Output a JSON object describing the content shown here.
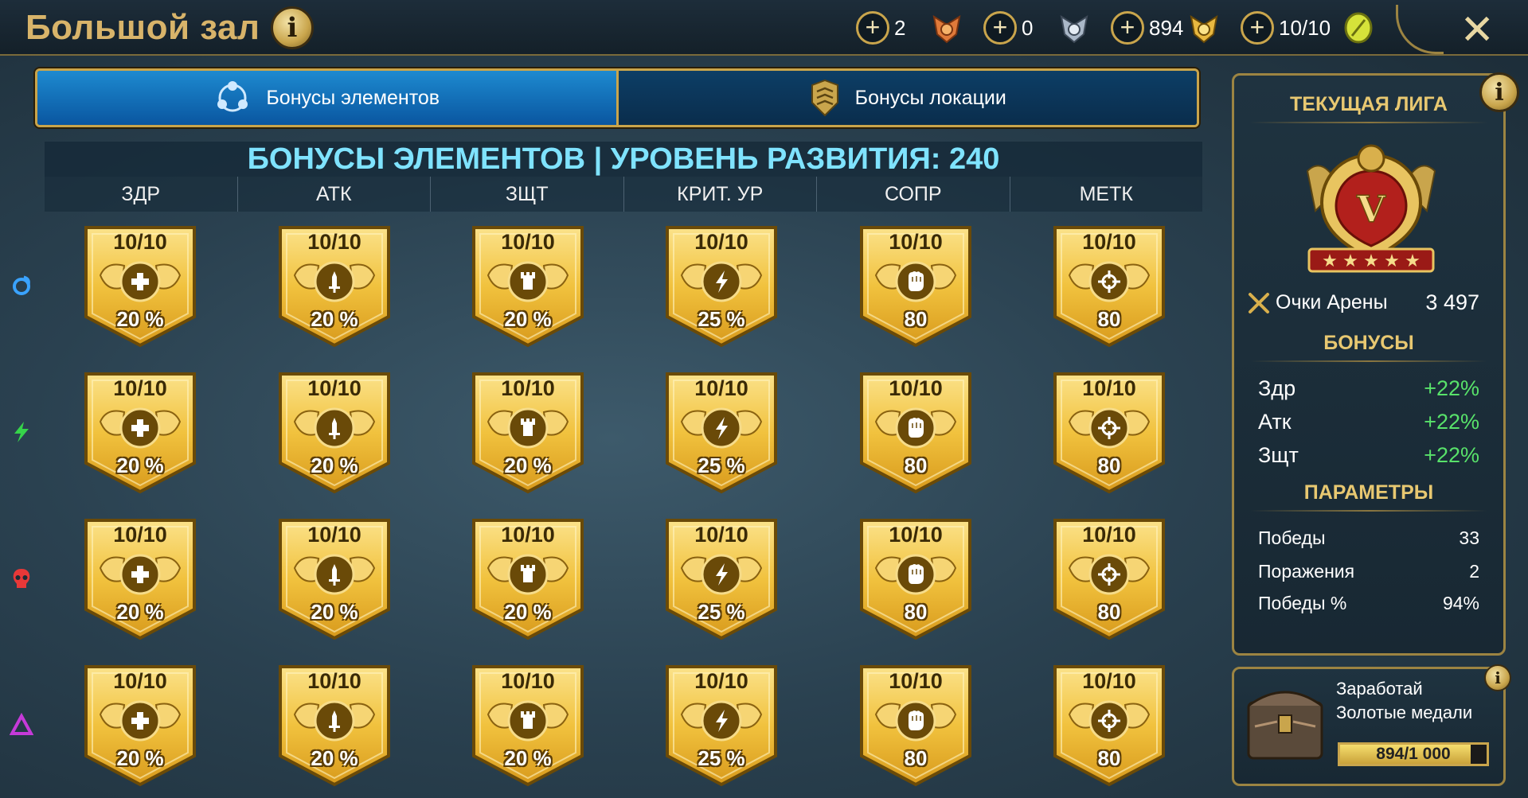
{
  "header": {
    "title": "Большой зал",
    "resources": [
      {
        "value": "2",
        "icon": "orange-medal-icon",
        "color": "#e07a3a"
      },
      {
        "value": "0",
        "icon": "silver-medal-icon",
        "color": "#aab8c8"
      },
      {
        "value": "894",
        "icon": "gold-medal-icon",
        "color": "#e8b840"
      },
      {
        "value": "10/10",
        "icon": "arena-token-icon",
        "color": "#d6e23a"
      }
    ]
  },
  "tabs": [
    {
      "label": "Бонусы элементов",
      "active": true,
      "icon": "elements-icon"
    },
    {
      "label": "Бонусы локации",
      "active": false,
      "icon": "location-icon"
    }
  ],
  "grid": {
    "title": "БОНУСЫ ЭЛЕМЕНТОВ | УРОВЕНЬ РАЗВИТИЯ: 240",
    "columns": [
      {
        "label": "ЗДР",
        "icon": "health-icon"
      },
      {
        "label": "АТК",
        "icon": "sword-icon"
      },
      {
        "label": "ЗЩТ",
        "icon": "tower-icon"
      },
      {
        "label": "КРИТ. УР",
        "icon": "lightning-icon"
      },
      {
        "label": "СОПР",
        "icon": "fist-icon"
      },
      {
        "label": "МЕТК",
        "icon": "crosshair-icon"
      }
    ],
    "rows": [
      {
        "affinity": "magic",
        "icon": "magic-affinity-icon",
        "color": "#3aa3ff",
        "cells": [
          {
            "level": "10/10",
            "value": "20 %"
          },
          {
            "level": "10/10",
            "value": "20 %"
          },
          {
            "level": "10/10",
            "value": "20 %"
          },
          {
            "level": "10/10",
            "value": "25 %"
          },
          {
            "level": "10/10",
            "value": "80"
          },
          {
            "level": "10/10",
            "value": "80"
          }
        ]
      },
      {
        "affinity": "spirit",
        "icon": "spirit-affinity-icon",
        "color": "#36d44a",
        "cells": [
          {
            "level": "10/10",
            "value": "20 %"
          },
          {
            "level": "10/10",
            "value": "20 %"
          },
          {
            "level": "10/10",
            "value": "20 %"
          },
          {
            "level": "10/10",
            "value": "25 %"
          },
          {
            "level": "10/10",
            "value": "80"
          },
          {
            "level": "10/10",
            "value": "80"
          }
        ]
      },
      {
        "affinity": "force",
        "icon": "force-affinity-icon",
        "color": "#e83838",
        "cells": [
          {
            "level": "10/10",
            "value": "20 %"
          },
          {
            "level": "10/10",
            "value": "20 %"
          },
          {
            "level": "10/10",
            "value": "20 %"
          },
          {
            "level": "10/10",
            "value": "25 %"
          },
          {
            "level": "10/10",
            "value": "80"
          },
          {
            "level": "10/10",
            "value": "80"
          }
        ]
      },
      {
        "affinity": "void",
        "icon": "void-affinity-icon",
        "color": "#c53ad8",
        "cells": [
          {
            "level": "10/10",
            "value": "20 %"
          },
          {
            "level": "10/10",
            "value": "20 %"
          },
          {
            "level": "10/10",
            "value": "20 %"
          },
          {
            "level": "10/10",
            "value": "25 %"
          },
          {
            "level": "10/10",
            "value": "80"
          },
          {
            "level": "10/10",
            "value": "80"
          }
        ]
      }
    ]
  },
  "league": {
    "title": "ТЕКУЩАЯ ЛИГА",
    "rank": "V",
    "points_label": "Очки Арены",
    "points_value": "3 497",
    "bonuses_title": "БОНУСЫ",
    "bonuses": [
      {
        "label": "Здр",
        "value": "+22%"
      },
      {
        "label": "Атк",
        "value": "+22%"
      },
      {
        "label": "Зщт",
        "value": "+22%"
      }
    ],
    "params_title": "ПАРАМЕТРЫ",
    "params": [
      {
        "label": "Победы",
        "value": "33"
      },
      {
        "label": "Поражения",
        "value": "2"
      },
      {
        "label": "Победы %",
        "value": "94%"
      }
    ]
  },
  "earn": {
    "line1": "Заработай",
    "line2": "Золотые медали",
    "progress_text": "894/1 000",
    "progress_fraction": 0.894
  }
}
